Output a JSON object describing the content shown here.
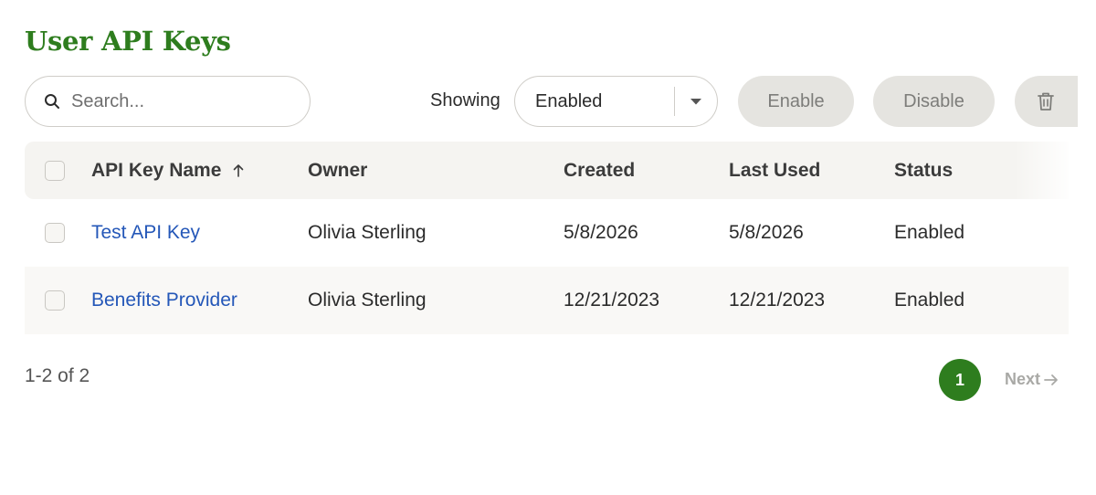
{
  "page": {
    "title": "User API Keys"
  },
  "toolbar": {
    "search_placeholder": "Search...",
    "search_value": "",
    "showing_label": "Showing",
    "filter_selected": "Enabled",
    "enable_label": "Enable",
    "disable_label": "Disable",
    "delete_icon": "trash-icon"
  },
  "table": {
    "columns": [
      "API Key Name",
      "Owner",
      "Created",
      "Last Used",
      "Status"
    ],
    "sort_column": "API Key Name",
    "sort_direction": "ascending",
    "rows": [
      {
        "name": "Test API Key",
        "owner": "Olivia Sterling",
        "created": "5/8/2026",
        "last_used": "5/8/2026",
        "status": "Enabled"
      },
      {
        "name": "Benefits Provider",
        "owner": "Olivia Sterling",
        "created": "12/21/2023",
        "last_used": "12/21/2023",
        "status": "Enabled"
      }
    ]
  },
  "pagination": {
    "range_text": "1-2 of 2",
    "current_page": "1",
    "next_label": "Next"
  },
  "colors": {
    "brand_green": "#2e7d1e",
    "link_blue": "#2457b8",
    "disabled_button_bg": "#e5e4e0"
  }
}
